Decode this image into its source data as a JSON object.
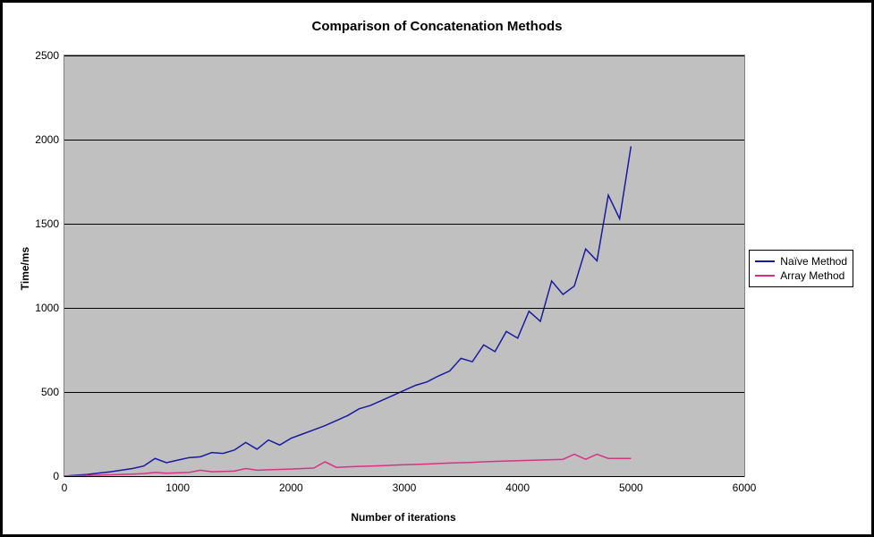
{
  "chart_data": {
    "type": "line",
    "title": "Comparison of Concatenation Methods",
    "xlabel": "Number of iterations",
    "ylabel": "Time/ms",
    "xlim": [
      0,
      6000
    ],
    "ylim": [
      0,
      2500
    ],
    "xticks": [
      0,
      1000,
      2000,
      3000,
      4000,
      5000,
      6000
    ],
    "yticks": [
      0,
      500,
      1000,
      1500,
      2000,
      2500
    ],
    "x": [
      0,
      100,
      200,
      300,
      400,
      500,
      600,
      700,
      800,
      900,
      1000,
      1100,
      1200,
      1300,
      1400,
      1500,
      1600,
      1700,
      1800,
      1900,
      2000,
      2100,
      2200,
      2300,
      2400,
      2500,
      2600,
      2700,
      2800,
      2900,
      3000,
      3100,
      3200,
      3300,
      3400,
      3500,
      3600,
      3700,
      3800,
      3900,
      4000,
      4100,
      4200,
      4300,
      4400,
      4500,
      4600,
      4700,
      4800,
      4900,
      5000
    ],
    "series": [
      {
        "name": "Naïve Method",
        "color": "#1a1aa0",
        "values": [
          0,
          5,
          10,
          18,
          25,
          35,
          45,
          60,
          105,
          80,
          95,
          110,
          115,
          140,
          135,
          155,
          200,
          160,
          215,
          185,
          225,
          250,
          275,
          300,
          330,
          360,
          400,
          420,
          450,
          480,
          510,
          540,
          560,
          595,
          625,
          700,
          680,
          780,
          740,
          860,
          820,
          980,
          920,
          1160,
          1080,
          1130,
          1350,
          1280,
          1670,
          1530,
          1960
        ]
      },
      {
        "name": "Array Method",
        "color": "#d63384",
        "values": [
          0,
          2,
          4,
          6,
          8,
          10,
          12,
          15,
          22,
          17,
          20,
          22,
          35,
          26,
          28,
          30,
          45,
          35,
          38,
          40,
          42,
          45,
          48,
          85,
          52,
          55,
          58,
          60,
          62,
          65,
          68,
          70,
          72,
          75,
          78,
          80,
          82,
          85,
          88,
          90,
          92,
          94,
          96,
          98,
          100,
          130,
          100,
          130,
          105,
          105,
          105
        ]
      }
    ],
    "legend_position": "right",
    "grid": true
  }
}
